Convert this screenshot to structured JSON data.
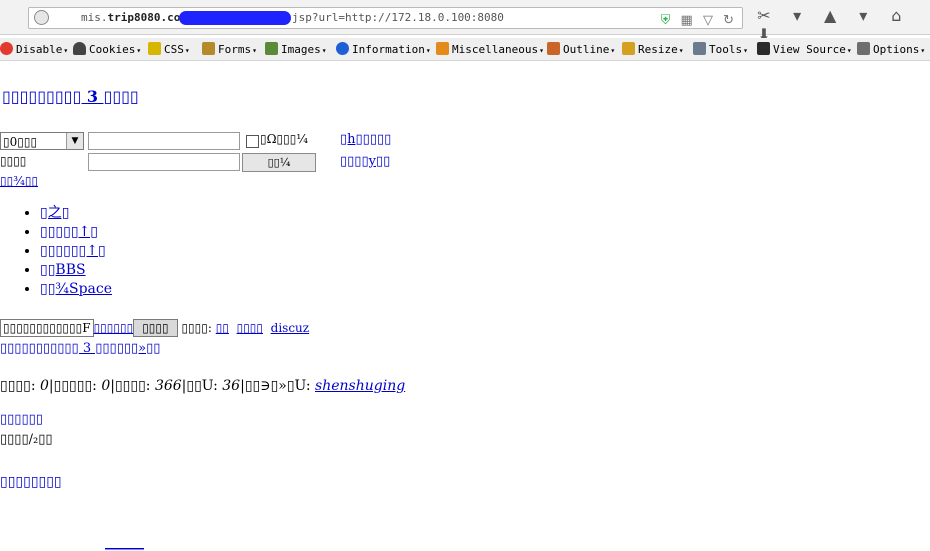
{
  "browser": {
    "url_prefix": "mis.",
    "url_domain": "trip8080.com",
    "url_suffix": "jsp?url=http://172.18.0.100:8080"
  },
  "toolbar": {
    "disable": "Disable",
    "cookies": "Cookies",
    "css": "CSS",
    "forms": "Forms",
    "images": "Images",
    "information": "Information",
    "miscellaneous": "Miscellaneous",
    "outline": "Outline",
    "resize": "Resize",
    "tools": "Tools",
    "view_source": "View Source",
    "options": "Options"
  },
  "page": {
    "title": "▯▯▯▯▯▯▯▯▯ 3 ▯▯▯▯",
    "search": {
      "select_value": "▯0▯▯▯",
      "query_value": "",
      "checkbox_label": "▯Ω▯▯▯¼",
      "advanced_link": "▯h▯▯▯▯▯",
      "label2": "▯▯▯▯",
      "input2_value": "",
      "button_label": "▯▯¼",
      "link2": "▯▯▯▯y▯▯",
      "link3": "▯▯¾▯▯"
    },
    "menu": [
      "▯之▯",
      "▯▯▯▯▯↑▯",
      "▯▯▯▯▯▯↑▯",
      "▯▯BBS",
      "▯▯¾Space"
    ],
    "tab_a_label": "▯▯▯▯▯▯▯▯▯▯▯▯F",
    "tab_b_label": "▯▯▯▯",
    "tabs_extra": "▯▯▯▯▯▯",
    "line4_text": "▯▯▯▯: ",
    "line4_links": [
      "▯▯",
      "▯▯▯▯",
      "discuz"
    ],
    "line5": "▯▯▯▯▯▯▯▯▯▯▯ 3 ▯▯▯▯▯▯»▯▯",
    "stats": {
      "a_label": "▯▯▯▯: ",
      "a_value": "0",
      "b_label": "▯▯▯▯▯: ",
      "b_value": "0",
      "c_label": "▯▯▯▯: ",
      "c_value": "366",
      "d_label": "▯▯U: ",
      "d_value": "36",
      "e_label": "▯▯∋▯»▯U: ",
      "e_value": "shenshuging"
    },
    "section1": "▯▯▯▯▯▯",
    "section2": "▯▯▯▯/₂▯▯",
    "section3": "▯▯▯▯▯▯▯▯",
    "bottom_link": "______"
  }
}
